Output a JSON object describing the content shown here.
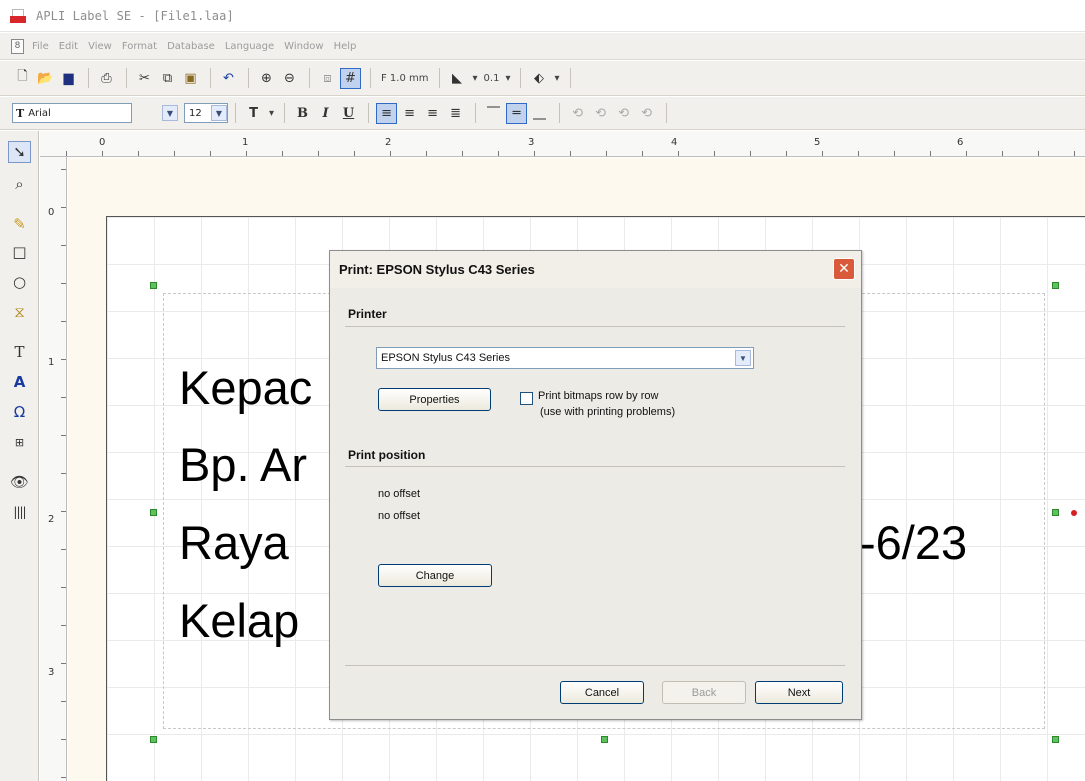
{
  "window": {
    "title": "APLI Label SE - [File1.laa]"
  },
  "menu": {
    "items": [
      "File",
      "Edit",
      "View",
      "Format",
      "Database",
      "Language",
      "Window",
      "Help"
    ]
  },
  "toolbar": {
    "line_spacing": "F 1.0 mm",
    "line_width": "0.1"
  },
  "format_bar": {
    "font": "Arial",
    "size": "12"
  },
  "ruler": {
    "h_labels": [
      "0",
      "1",
      "2",
      "3",
      "4",
      "5",
      "6"
    ],
    "v_labels": [
      "0",
      "1",
      "2",
      "3"
    ]
  },
  "label": {
    "lines": [
      "Kepac",
      "Bp. Ar",
      "Raya",
      "Kelap"
    ],
    "line3_tail": "-6/23"
  },
  "dialog": {
    "title": "Print: EPSON Stylus C43 Series",
    "printer_section": "Printer",
    "printer_value": "EPSON Stylus C43 Series",
    "properties_label": "Properties",
    "checkbox_label": "Print bitmaps row by row",
    "checkbox_hint": "(use with printing problems)",
    "checkbox_checked": false,
    "position_section": "Print position",
    "offset_1": "no offset",
    "offset_2": "no offset",
    "change_label": "Change",
    "cancel_label": "Cancel",
    "back_label": "Back",
    "next_label": "Next"
  }
}
